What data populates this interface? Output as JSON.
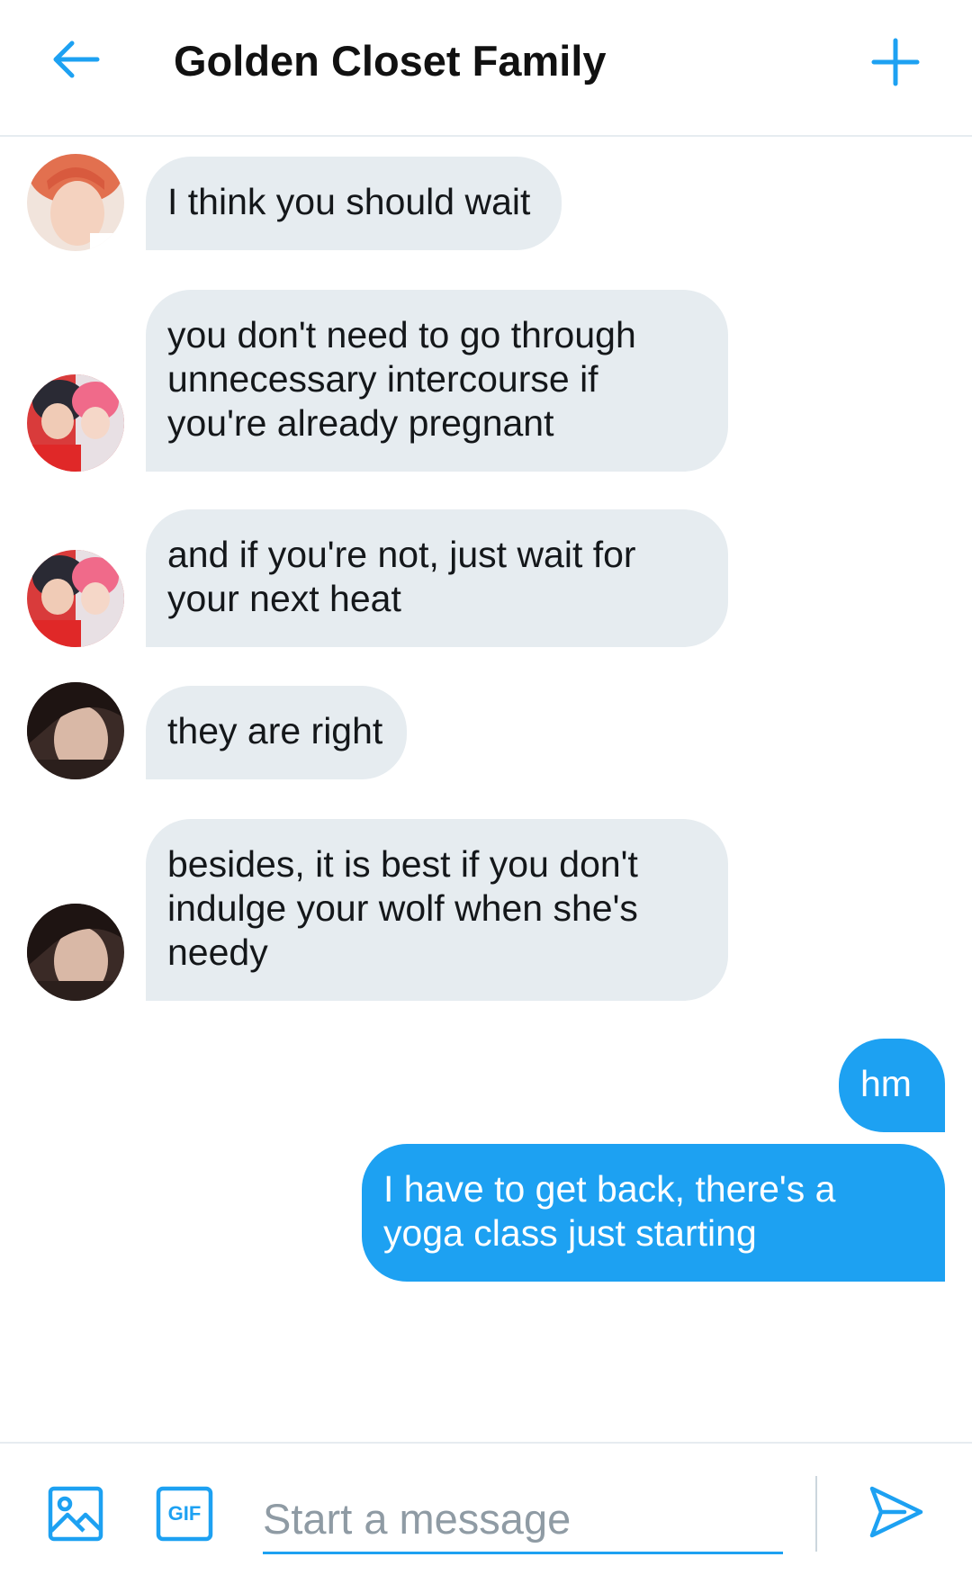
{
  "header": {
    "title": "Golden Closet Family",
    "back_icon": "arrow-left-icon",
    "add_icon": "plus-icon",
    "accent_color": "#1da1f2"
  },
  "messages": [
    {
      "direction": "incoming",
      "text": "I think you should wait",
      "avatar": "avatar-red-hair"
    },
    {
      "direction": "incoming",
      "text": "you don't need to go through unnecessary intercourse if you're already pregnant",
      "avatar": "avatar-pair-photo"
    },
    {
      "direction": "incoming",
      "text": "and if you're not, just wait for your next heat",
      "avatar": "avatar-pair-photo"
    },
    {
      "direction": "incoming",
      "text": "they are right",
      "avatar": "avatar-dark-hair"
    },
    {
      "direction": "incoming",
      "text": "besides, it is best if you don't indulge your wolf when she's needy",
      "avatar": "avatar-dark-hair"
    },
    {
      "direction": "outgoing",
      "text": "hm"
    },
    {
      "direction": "outgoing",
      "text": "I have to get back, there's a yoga class just starting"
    }
  ],
  "composer": {
    "placeholder": "Start a message",
    "value": "",
    "media_icon": "image-icon",
    "gif_icon": "gif-icon",
    "gif_label": "GIF",
    "send_icon": "send-icon"
  },
  "colors": {
    "incoming_bubble": "#e6ecf0",
    "outgoing_bubble": "#1da1f2"
  }
}
